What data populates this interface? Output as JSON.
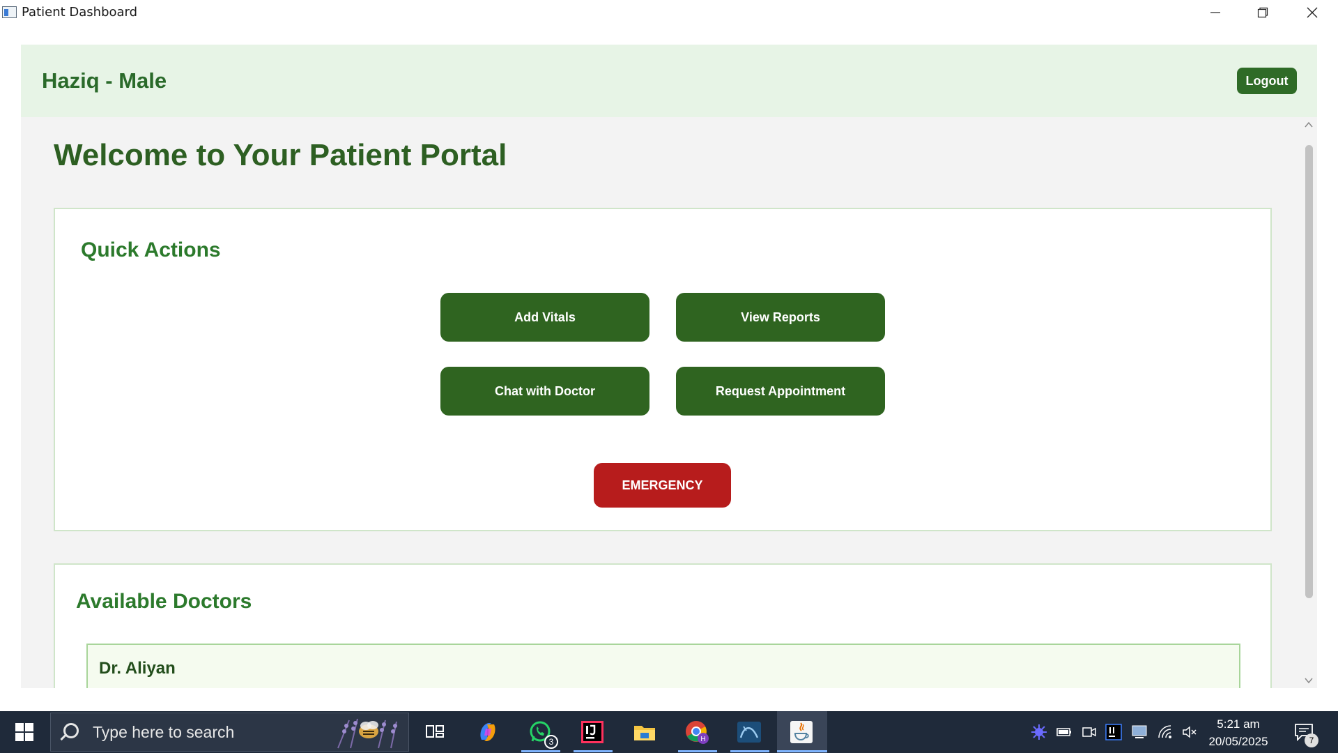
{
  "window": {
    "title": "Patient Dashboard",
    "icons": [
      "app-window-icon",
      "minimize-icon",
      "maximize-icon",
      "close-icon"
    ]
  },
  "header": {
    "patient_label": "Haziq - Male",
    "logout_label": "Logout",
    "background_color": "#e7f4e6",
    "accent_color": "#2f6b27"
  },
  "main": {
    "welcome_title": "Welcome to Your Patient Portal",
    "quick_actions": {
      "title": "Quick Actions",
      "buttons": [
        {
          "label": "Add Vitals"
        },
        {
          "label": "View Reports"
        },
        {
          "label": "Chat with Doctor"
        },
        {
          "label": "Request Appointment"
        }
      ],
      "emergency_label": "EMERGENCY",
      "button_color": "#2f6420",
      "emergency_color": "#b71c1c"
    },
    "available_doctors": {
      "title": "Available Doctors",
      "doctors": [
        {
          "name": "Dr. Aliyan"
        }
      ]
    }
  },
  "taskbar": {
    "search_placeholder": "Type here to search",
    "apps": [
      "task-view-icon",
      "copilot-icon",
      "whatsapp-icon",
      "intellij-icon",
      "file-explorer-icon",
      "chrome-icon",
      "mysql-workbench-icon",
      "java-icon"
    ],
    "whatsapp_badge": "3",
    "tray_icons": [
      "widget-icon",
      "battery-icon",
      "meet-icon",
      "intellij-tray-icon",
      "display-icon",
      "wifi-icon",
      "mute-icon"
    ],
    "clock_time": "5:21 am",
    "clock_date": "20/05/2025",
    "notification_count": "7"
  }
}
